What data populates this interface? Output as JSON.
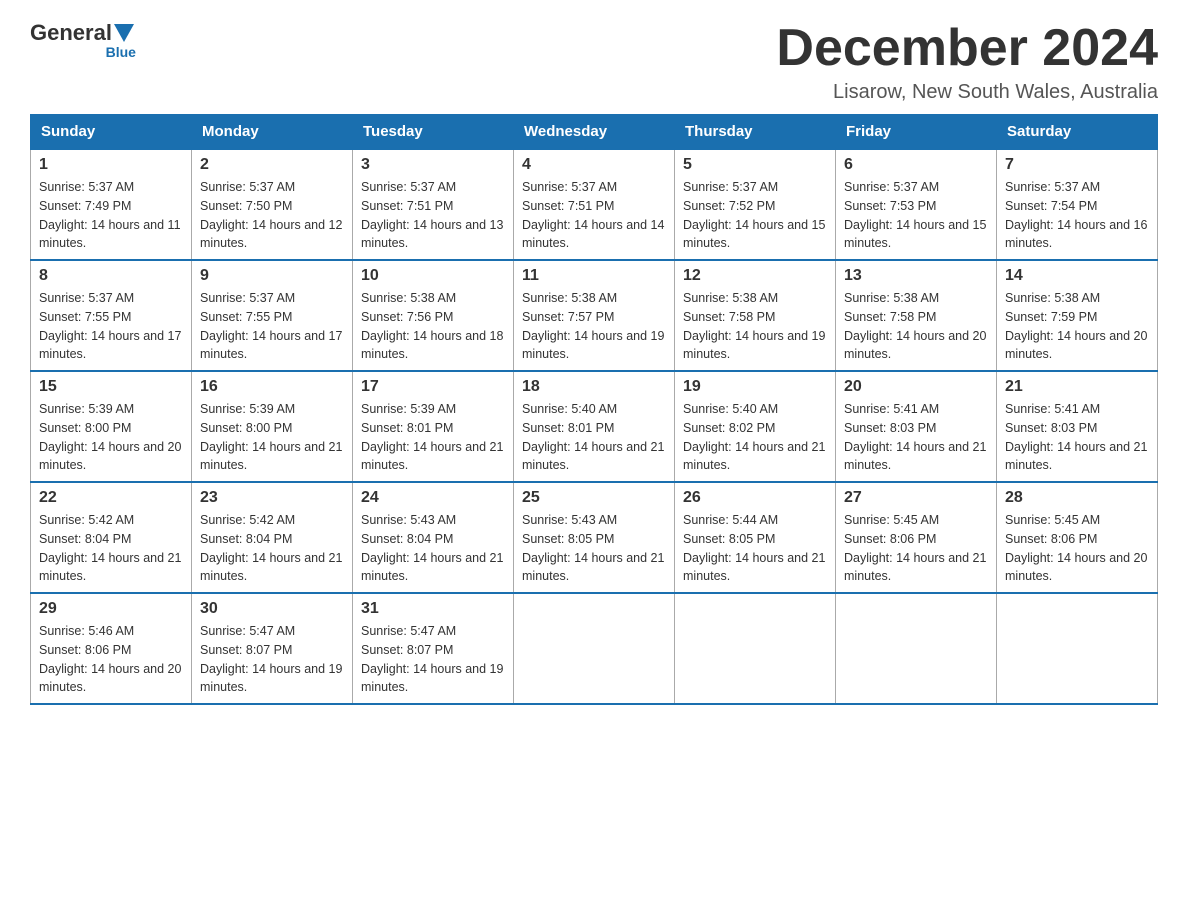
{
  "header": {
    "logo": {
      "general": "General",
      "blue": "Blue"
    },
    "month_title": "December 2024",
    "location": "Lisarow, New South Wales, Australia"
  },
  "days_of_week": [
    "Sunday",
    "Monday",
    "Tuesday",
    "Wednesday",
    "Thursday",
    "Friday",
    "Saturday"
  ],
  "weeks": [
    [
      {
        "day": "1",
        "sunrise": "Sunrise: 5:37 AM",
        "sunset": "Sunset: 7:49 PM",
        "daylight": "Daylight: 14 hours and 11 minutes."
      },
      {
        "day": "2",
        "sunrise": "Sunrise: 5:37 AM",
        "sunset": "Sunset: 7:50 PM",
        "daylight": "Daylight: 14 hours and 12 minutes."
      },
      {
        "day": "3",
        "sunrise": "Sunrise: 5:37 AM",
        "sunset": "Sunset: 7:51 PM",
        "daylight": "Daylight: 14 hours and 13 minutes."
      },
      {
        "day": "4",
        "sunrise": "Sunrise: 5:37 AM",
        "sunset": "Sunset: 7:51 PM",
        "daylight": "Daylight: 14 hours and 14 minutes."
      },
      {
        "day": "5",
        "sunrise": "Sunrise: 5:37 AM",
        "sunset": "Sunset: 7:52 PM",
        "daylight": "Daylight: 14 hours and 15 minutes."
      },
      {
        "day": "6",
        "sunrise": "Sunrise: 5:37 AM",
        "sunset": "Sunset: 7:53 PM",
        "daylight": "Daylight: 14 hours and 15 minutes."
      },
      {
        "day": "7",
        "sunrise": "Sunrise: 5:37 AM",
        "sunset": "Sunset: 7:54 PM",
        "daylight": "Daylight: 14 hours and 16 minutes."
      }
    ],
    [
      {
        "day": "8",
        "sunrise": "Sunrise: 5:37 AM",
        "sunset": "Sunset: 7:55 PM",
        "daylight": "Daylight: 14 hours and 17 minutes."
      },
      {
        "day": "9",
        "sunrise": "Sunrise: 5:37 AM",
        "sunset": "Sunset: 7:55 PM",
        "daylight": "Daylight: 14 hours and 17 minutes."
      },
      {
        "day": "10",
        "sunrise": "Sunrise: 5:38 AM",
        "sunset": "Sunset: 7:56 PM",
        "daylight": "Daylight: 14 hours and 18 minutes."
      },
      {
        "day": "11",
        "sunrise": "Sunrise: 5:38 AM",
        "sunset": "Sunset: 7:57 PM",
        "daylight": "Daylight: 14 hours and 19 minutes."
      },
      {
        "day": "12",
        "sunrise": "Sunrise: 5:38 AM",
        "sunset": "Sunset: 7:58 PM",
        "daylight": "Daylight: 14 hours and 19 minutes."
      },
      {
        "day": "13",
        "sunrise": "Sunrise: 5:38 AM",
        "sunset": "Sunset: 7:58 PM",
        "daylight": "Daylight: 14 hours and 20 minutes."
      },
      {
        "day": "14",
        "sunrise": "Sunrise: 5:38 AM",
        "sunset": "Sunset: 7:59 PM",
        "daylight": "Daylight: 14 hours and 20 minutes."
      }
    ],
    [
      {
        "day": "15",
        "sunrise": "Sunrise: 5:39 AM",
        "sunset": "Sunset: 8:00 PM",
        "daylight": "Daylight: 14 hours and 20 minutes."
      },
      {
        "day": "16",
        "sunrise": "Sunrise: 5:39 AM",
        "sunset": "Sunset: 8:00 PM",
        "daylight": "Daylight: 14 hours and 21 minutes."
      },
      {
        "day": "17",
        "sunrise": "Sunrise: 5:39 AM",
        "sunset": "Sunset: 8:01 PM",
        "daylight": "Daylight: 14 hours and 21 minutes."
      },
      {
        "day": "18",
        "sunrise": "Sunrise: 5:40 AM",
        "sunset": "Sunset: 8:01 PM",
        "daylight": "Daylight: 14 hours and 21 minutes."
      },
      {
        "day": "19",
        "sunrise": "Sunrise: 5:40 AM",
        "sunset": "Sunset: 8:02 PM",
        "daylight": "Daylight: 14 hours and 21 minutes."
      },
      {
        "day": "20",
        "sunrise": "Sunrise: 5:41 AM",
        "sunset": "Sunset: 8:03 PM",
        "daylight": "Daylight: 14 hours and 21 minutes."
      },
      {
        "day": "21",
        "sunrise": "Sunrise: 5:41 AM",
        "sunset": "Sunset: 8:03 PM",
        "daylight": "Daylight: 14 hours and 21 minutes."
      }
    ],
    [
      {
        "day": "22",
        "sunrise": "Sunrise: 5:42 AM",
        "sunset": "Sunset: 8:04 PM",
        "daylight": "Daylight: 14 hours and 21 minutes."
      },
      {
        "day": "23",
        "sunrise": "Sunrise: 5:42 AM",
        "sunset": "Sunset: 8:04 PM",
        "daylight": "Daylight: 14 hours and 21 minutes."
      },
      {
        "day": "24",
        "sunrise": "Sunrise: 5:43 AM",
        "sunset": "Sunset: 8:04 PM",
        "daylight": "Daylight: 14 hours and 21 minutes."
      },
      {
        "day": "25",
        "sunrise": "Sunrise: 5:43 AM",
        "sunset": "Sunset: 8:05 PM",
        "daylight": "Daylight: 14 hours and 21 minutes."
      },
      {
        "day": "26",
        "sunrise": "Sunrise: 5:44 AM",
        "sunset": "Sunset: 8:05 PM",
        "daylight": "Daylight: 14 hours and 21 minutes."
      },
      {
        "day": "27",
        "sunrise": "Sunrise: 5:45 AM",
        "sunset": "Sunset: 8:06 PM",
        "daylight": "Daylight: 14 hours and 21 minutes."
      },
      {
        "day": "28",
        "sunrise": "Sunrise: 5:45 AM",
        "sunset": "Sunset: 8:06 PM",
        "daylight": "Daylight: 14 hours and 20 minutes."
      }
    ],
    [
      {
        "day": "29",
        "sunrise": "Sunrise: 5:46 AM",
        "sunset": "Sunset: 8:06 PM",
        "daylight": "Daylight: 14 hours and 20 minutes."
      },
      {
        "day": "30",
        "sunrise": "Sunrise: 5:47 AM",
        "sunset": "Sunset: 8:07 PM",
        "daylight": "Daylight: 14 hours and 19 minutes."
      },
      {
        "day": "31",
        "sunrise": "Sunrise: 5:47 AM",
        "sunset": "Sunset: 8:07 PM",
        "daylight": "Daylight: 14 hours and 19 minutes."
      },
      null,
      null,
      null,
      null
    ]
  ]
}
